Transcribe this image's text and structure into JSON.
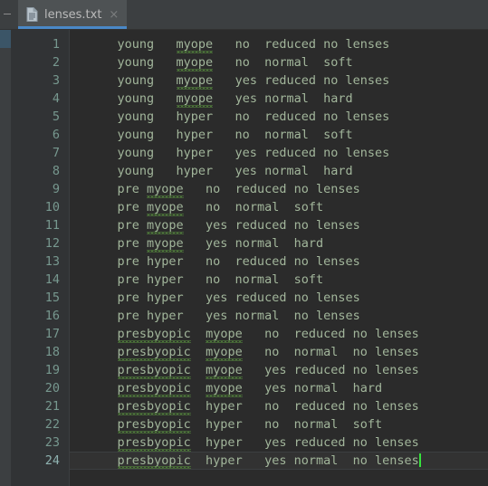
{
  "window": {
    "background_color": "#2b2b2b",
    "chrome_color": "#3c3f41"
  },
  "tab_bar": {
    "active_tab": {
      "label": "lenses.txt",
      "icon": "text-file-icon",
      "close_label": "×",
      "underline_color": "#4a88c7",
      "background_color": "#4e5254"
    }
  },
  "gutter": {
    "marker_line": 8,
    "marker_color": "#3b5567",
    "line_number_color": "#77988f",
    "background_color": "#313335"
  },
  "editor": {
    "text_color": "#a2b69b",
    "current_line": 24,
    "current_line_background": "#323232",
    "caret_color": "#36e23c",
    "spellcheck_color": "#4e7a3a",
    "misspelled_words": [
      "myope",
      "presbyopic"
    ],
    "lines": [
      {
        "n": "1",
        "segments": [
          {
            "t": "    young   "
          },
          {
            "t": "myope",
            "squiggle": true
          },
          {
            "t": "   no  reduced no lenses"
          }
        ]
      },
      {
        "n": "2",
        "segments": [
          {
            "t": "    young   "
          },
          {
            "t": "myope",
            "squiggle": true
          },
          {
            "t": "   no  normal  soft"
          }
        ]
      },
      {
        "n": "3",
        "segments": [
          {
            "t": "    young   "
          },
          {
            "t": "myope",
            "squiggle": true
          },
          {
            "t": "   yes reduced no lenses"
          }
        ]
      },
      {
        "n": "4",
        "segments": [
          {
            "t": "    young   "
          },
          {
            "t": "myope",
            "squiggle": true
          },
          {
            "t": "   yes normal  hard"
          }
        ]
      },
      {
        "n": "5",
        "segments": [
          {
            "t": "    young   hyper   no  reduced no lenses"
          }
        ]
      },
      {
        "n": "6",
        "segments": [
          {
            "t": "    young   hyper   no  normal  soft"
          }
        ]
      },
      {
        "n": "7",
        "segments": [
          {
            "t": "    young   hyper   yes reduced no lenses"
          }
        ]
      },
      {
        "n": "8",
        "segments": [
          {
            "t": "    young   hyper   yes normal  hard"
          }
        ]
      },
      {
        "n": "9",
        "segments": [
          {
            "t": "    pre "
          },
          {
            "t": "myope",
            "squiggle": true
          },
          {
            "t": "   no  reduced no lenses"
          }
        ]
      },
      {
        "n": "10",
        "segments": [
          {
            "t": "    pre "
          },
          {
            "t": "myope",
            "squiggle": true
          },
          {
            "t": "   no  normal  soft"
          }
        ]
      },
      {
        "n": "11",
        "segments": [
          {
            "t": "    pre "
          },
          {
            "t": "myope",
            "squiggle": true
          },
          {
            "t": "   yes reduced no lenses"
          }
        ]
      },
      {
        "n": "12",
        "segments": [
          {
            "t": "    pre "
          },
          {
            "t": "myope",
            "squiggle": true
          },
          {
            "t": "   yes normal  hard"
          }
        ]
      },
      {
        "n": "13",
        "segments": [
          {
            "t": "    pre hyper   no  reduced no lenses"
          }
        ]
      },
      {
        "n": "14",
        "segments": [
          {
            "t": "    pre hyper   no  normal  soft"
          }
        ]
      },
      {
        "n": "15",
        "segments": [
          {
            "t": "    pre hyper   yes reduced no lenses"
          }
        ]
      },
      {
        "n": "16",
        "segments": [
          {
            "t": "    pre hyper   yes normal  no lenses"
          }
        ]
      },
      {
        "n": "17",
        "segments": [
          {
            "t": "    "
          },
          {
            "t": "presbyopic",
            "squiggle": true
          },
          {
            "t": "  "
          },
          {
            "t": "myope",
            "squiggle": true
          },
          {
            "t": "   no  reduced no lenses"
          }
        ]
      },
      {
        "n": "18",
        "segments": [
          {
            "t": "    "
          },
          {
            "t": "presbyopic",
            "squiggle": true
          },
          {
            "t": "  "
          },
          {
            "t": "myope",
            "squiggle": true
          },
          {
            "t": "   no  normal  no lenses"
          }
        ]
      },
      {
        "n": "19",
        "segments": [
          {
            "t": "    "
          },
          {
            "t": "presbyopic",
            "squiggle": true
          },
          {
            "t": "  "
          },
          {
            "t": "myope",
            "squiggle": true
          },
          {
            "t": "   yes reduced no lenses"
          }
        ]
      },
      {
        "n": "20",
        "segments": [
          {
            "t": "    "
          },
          {
            "t": "presbyopic",
            "squiggle": true
          },
          {
            "t": "  "
          },
          {
            "t": "myope",
            "squiggle": true
          },
          {
            "t": "   yes normal  hard"
          }
        ]
      },
      {
        "n": "21",
        "segments": [
          {
            "t": "    "
          },
          {
            "t": "presbyopic",
            "squiggle": true
          },
          {
            "t": "  hyper   no  reduced no lenses"
          }
        ]
      },
      {
        "n": "22",
        "segments": [
          {
            "t": "    "
          },
          {
            "t": "presbyopic",
            "squiggle": true
          },
          {
            "t": "  hyper   no  normal  soft"
          }
        ]
      },
      {
        "n": "23",
        "segments": [
          {
            "t": "    "
          },
          {
            "t": "presbyopic",
            "squiggle": true
          },
          {
            "t": "  hyper   yes reduced no lenses"
          }
        ]
      },
      {
        "n": "24",
        "segments": [
          {
            "t": "    "
          },
          {
            "t": "presbyopic",
            "squiggle": true
          },
          {
            "t": "  hyper   yes normal  no lenses"
          }
        ],
        "caret_at_end": true
      }
    ]
  }
}
